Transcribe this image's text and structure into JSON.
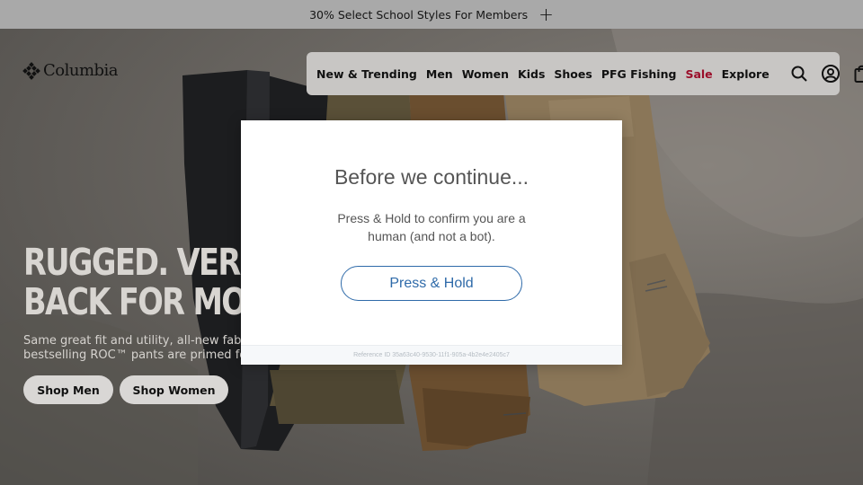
{
  "promo": {
    "text": "30% Select School Styles For Members",
    "expand_icon": "plus-icon"
  },
  "brand": {
    "name": "Columbia",
    "logo_icon": "columbia-diamond-logo"
  },
  "nav": {
    "items": [
      {
        "label": "New & Trending"
      },
      {
        "label": "Men"
      },
      {
        "label": "Women"
      },
      {
        "label": "Kids"
      },
      {
        "label": "Shoes"
      },
      {
        "label": "PFG Fishing"
      },
      {
        "label": "Sale"
      },
      {
        "label": "Explore"
      }
    ],
    "icons": [
      "search-icon",
      "account-icon",
      "bag-icon"
    ],
    "sale_color": "#9b0e2a"
  },
  "hero": {
    "headline_line1": "RUGGED. VERSA",
    "headline_line2": "BACK FOR MOR",
    "subtext_line1": "Same great fit and utility, all-new fabr",
    "subtext_line2": "bestselling ROC™ pants are primed fo",
    "cta_men": "Shop Men",
    "cta_women": "Shop Women"
  },
  "modal": {
    "title": "Before we continue...",
    "description": "Press & Hold to confirm you are a human (and not a bot).",
    "button_label": "Press & Hold",
    "reference": "Reference ID 35a63c40-9530-11f1-905a-4b2e4e2405c7",
    "accent_color": "#2e6aa9"
  }
}
